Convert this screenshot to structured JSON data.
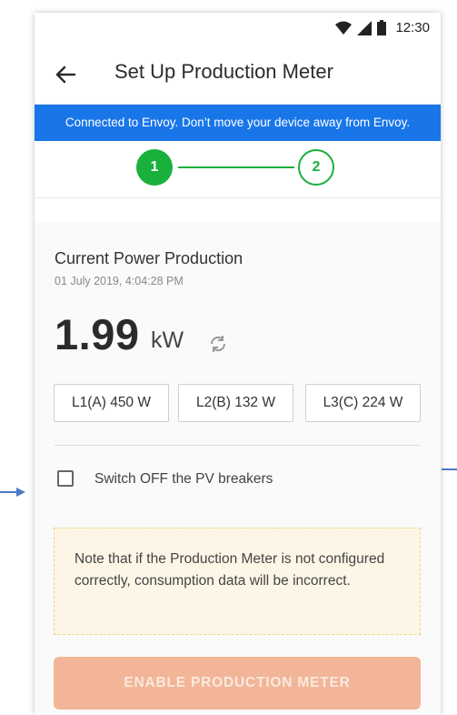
{
  "status_bar": {
    "time": "12:30",
    "icons": [
      "wifi-icon",
      "signal-icon",
      "battery-icon"
    ]
  },
  "app_bar": {
    "back_icon": "arrow-left-icon",
    "title": "Set Up Production Meter"
  },
  "banner": {
    "text": "Connected to Envoy. Don’t move your device away from Envoy.",
    "color": "#1976e9"
  },
  "stepper": {
    "steps": [
      {
        "label": "1",
        "state": "active"
      },
      {
        "label": "2",
        "state": "pending"
      }
    ],
    "accent": "#19b03c"
  },
  "production": {
    "title": "Current Power Production",
    "timestamp": "01 July 2019, 4:04:28 PM",
    "value": "1.99",
    "unit": "kW",
    "refresh_icon": "refresh-icon",
    "phases": [
      {
        "label": "L1(A) 450 W"
      },
      {
        "label": "L2(B) 132 W"
      },
      {
        "label": "L3(C) 224 W"
      }
    ]
  },
  "checkbox": {
    "label": "Switch OFF the PV breakers",
    "checked": false
  },
  "note": {
    "text": "Note that if the Production Meter is not configured correctly, consumption data will be incorrect."
  },
  "enable_button": {
    "label": "ENABLE PRODUCTION METER",
    "color": "#f2b597"
  }
}
